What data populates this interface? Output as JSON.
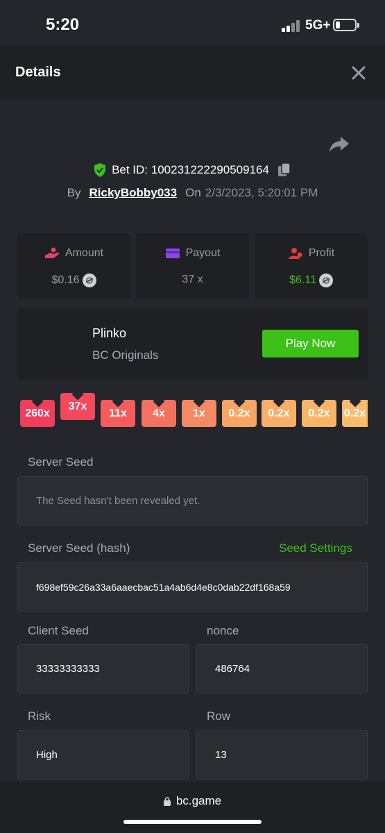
{
  "status_bar": {
    "time": "5:20",
    "network": "5G+"
  },
  "header": {
    "title": "Details"
  },
  "bet": {
    "id_label": "Bet ID: 100231222290509164",
    "by_label": "By",
    "username": "RickyBobby033",
    "on_label": "On",
    "date": "2/3/2023, 5:20:01 PM"
  },
  "stats": {
    "amount": {
      "label": "Amount",
      "value": "$0.16",
      "icon": "hand-coins-icon",
      "color": "#e2435f"
    },
    "payout": {
      "label": "Payout",
      "value": "37 x",
      "icon": "card-icon",
      "color": "#8b46ee"
    },
    "profit": {
      "label": "Profit",
      "value": "$6.11",
      "icon": "person-coin-icon",
      "color": "#e23d3d",
      "value_color": "#3bc117"
    }
  },
  "game": {
    "name": "Plinko",
    "provider": "BC Originals",
    "play_label": "Play Now"
  },
  "multipliers": [
    {
      "label": "260x",
      "color": "#f13d5c",
      "selected": false
    },
    {
      "label": "37x",
      "color": "#f24a5c",
      "selected": true
    },
    {
      "label": "11x",
      "color": "#f45c5c",
      "selected": false
    },
    {
      "label": "4x",
      "color": "#f4705f",
      "selected": false
    },
    {
      "label": "1x",
      "color": "#f68863",
      "selected": false
    },
    {
      "label": "0.2x",
      "color": "#f7a565",
      "selected": false
    },
    {
      "label": "0.2x",
      "color": "#f8ae68",
      "selected": false
    },
    {
      "label": "0.2x",
      "color": "#f8b56a",
      "selected": false
    },
    {
      "label": "0.2x",
      "color": "#f9bb6c",
      "selected": false
    }
  ],
  "fields": {
    "server_seed": {
      "label": "Server Seed",
      "value": "The Seed hasn't been revealed yet."
    },
    "server_seed_hash": {
      "label": "Server Seed (hash)",
      "value": "f698ef59c26a33a6aaecbac51a4ab6d4e8c0dab22df168a59",
      "settings_label": "Seed Settings"
    },
    "client_seed": {
      "label": "Client Seed",
      "value": "33333333333"
    },
    "nonce": {
      "label": "nonce",
      "value": "486764"
    },
    "risk": {
      "label": "Risk",
      "value": "High"
    },
    "row": {
      "label": "Row",
      "value": "13"
    }
  },
  "browser": {
    "url": "bc.game"
  },
  "colors": {
    "accent_green": "#3bc117",
    "background": "#24262b",
    "card": "#1e2024"
  }
}
